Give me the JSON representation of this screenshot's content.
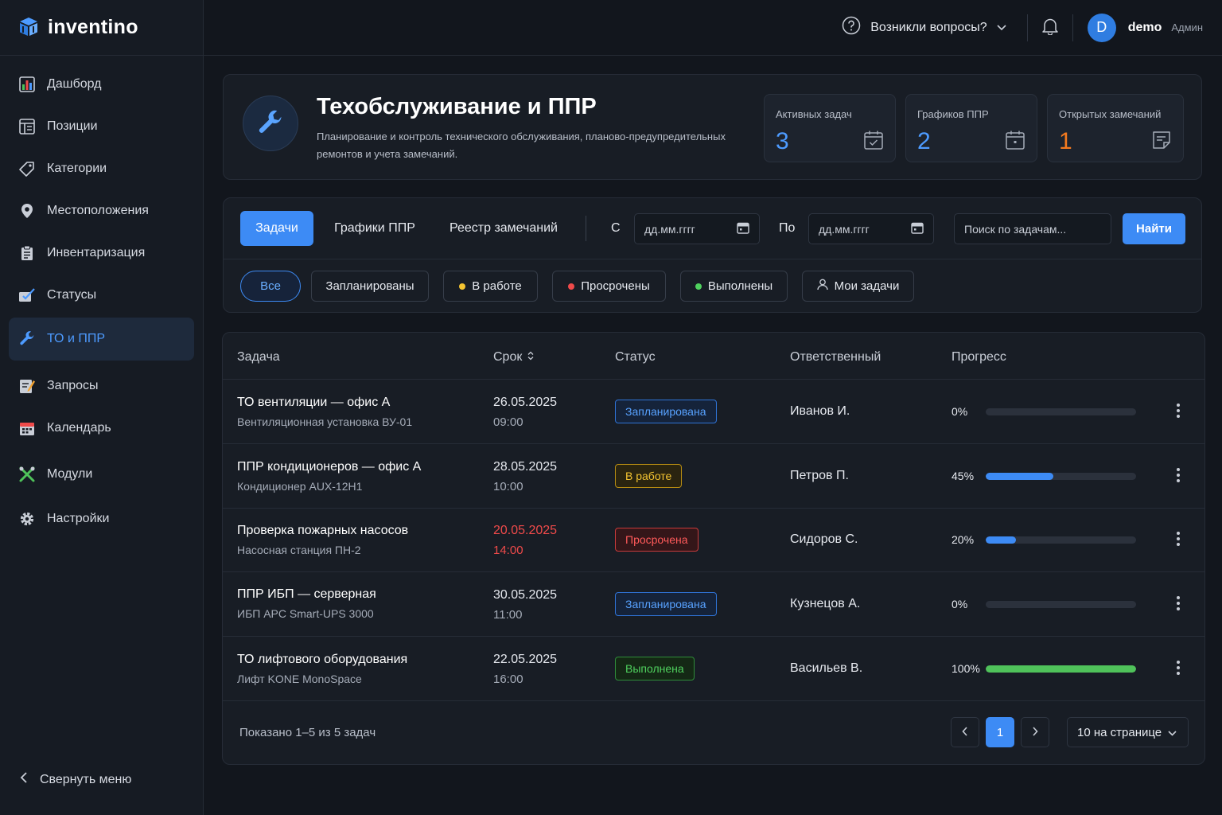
{
  "brand": {
    "name": "inventino"
  },
  "sidebar": {
    "items": [
      {
        "label": "Дашборд",
        "icon": "dashboard-icon"
      },
      {
        "label": "Позиции",
        "icon": "positions-icon"
      },
      {
        "label": "Категории",
        "icon": "tag-icon"
      },
      {
        "label": "Местоположения",
        "icon": "location-pin-icon"
      },
      {
        "label": "Инвентаризация",
        "icon": "clipboard-icon"
      },
      {
        "label": "Статусы",
        "icon": "status-icon"
      },
      {
        "label": "ТО и ППР",
        "icon": "wrench-icon",
        "active": true
      },
      {
        "label": "Запросы",
        "icon": "requests-icon"
      },
      {
        "label": "Календарь",
        "icon": "calendar-icon"
      },
      {
        "label": "Модули",
        "icon": "modules-icon"
      },
      {
        "label": "Настройки",
        "icon": "gear-icon"
      }
    ],
    "collapse_label": "Свернуть меню"
  },
  "topbar": {
    "help_label": "Возникли вопросы?",
    "avatar_letter": "D",
    "user_name": "demo",
    "user_role": "Админ"
  },
  "header": {
    "title": "Техобслуживание и ППР",
    "description": "Планирование и контроль технического обслуживания, планово-предупредительных ремонтов и учета замечаний.",
    "stats": [
      {
        "label": "Активных задач",
        "value": "3",
        "color": "#4d9bff"
      },
      {
        "label": "Графиков ППР",
        "value": "2",
        "color": "#4d9bff"
      },
      {
        "label": "Открытых замечаний",
        "value": "1",
        "color": "#f47a1f"
      }
    ]
  },
  "toolbar": {
    "tabs": [
      "Задачи",
      "Графики ППР",
      "Реестр замечаний"
    ],
    "from_label": "С",
    "to_label": "По",
    "date_placeholder": "дд.мм.гггг",
    "search_placeholder": "Поиск по задачам...",
    "find_label": "Найти",
    "filters": [
      {
        "label": "Все"
      },
      {
        "label": "Запланированы"
      },
      {
        "label": "В работе",
        "dot": "#f4c431"
      },
      {
        "label": "Просрочены",
        "dot": "#ef4a4a"
      },
      {
        "label": "Выполнены",
        "dot": "#4fd15e"
      },
      {
        "label": "Мои задачи"
      }
    ]
  },
  "table": {
    "headers": {
      "task": "Задача",
      "due": "Срок",
      "status": "Статус",
      "owner": "Ответственный",
      "progress": "Прогресс"
    },
    "rows": [
      {
        "title": "ТО вентиляции — офис А",
        "sub": "Вентиляционная установка ВУ-01",
        "date": "26.05.2025",
        "time": "09:00",
        "status": "Запланирована",
        "owner": "Иванов И.",
        "pct_label": "0%",
        "progress": 0
      },
      {
        "title": "ППР кондиционеров — офис А",
        "sub": "Кондиционер AUX-12H1",
        "date": "28.05.2025",
        "time": "10:00",
        "status": "В работе",
        "owner": "Петров П.",
        "pct_label": "45%",
        "progress": 45
      },
      {
        "title": "Проверка пожарных насосов",
        "sub": "Насосная станция ПН-2",
        "date": "20.05.2025",
        "time": "14:00",
        "status": "Просрочена",
        "owner": "Сидоров С.",
        "pct_label": "20%",
        "progress": 20
      },
      {
        "title": "ППР ИБП — серверная",
        "sub": "ИБП APC Smart-UPS 3000",
        "date": "30.05.2025",
        "time": "11:00",
        "status": "Запланирована",
        "owner": "Кузнецов А.",
        "pct_label": "0%",
        "progress": 0
      },
      {
        "title": "ТО лифтового оборудования",
        "sub": "Лифт KONE MonoSpace",
        "date": "22.05.2025",
        "time": "16:00",
        "status": "Выполнена",
        "owner": "Васильев В.",
        "pct_label": "100%",
        "progress": 100
      }
    ],
    "footer_text": "Показано 1–5 из 5 задач",
    "current_page": "1",
    "per_page": "10 на странице"
  },
  "colors": {
    "accent": "#3d8bf5",
    "progress_blue": "#3d8bf5",
    "progress_green": "#4fc25a"
  }
}
